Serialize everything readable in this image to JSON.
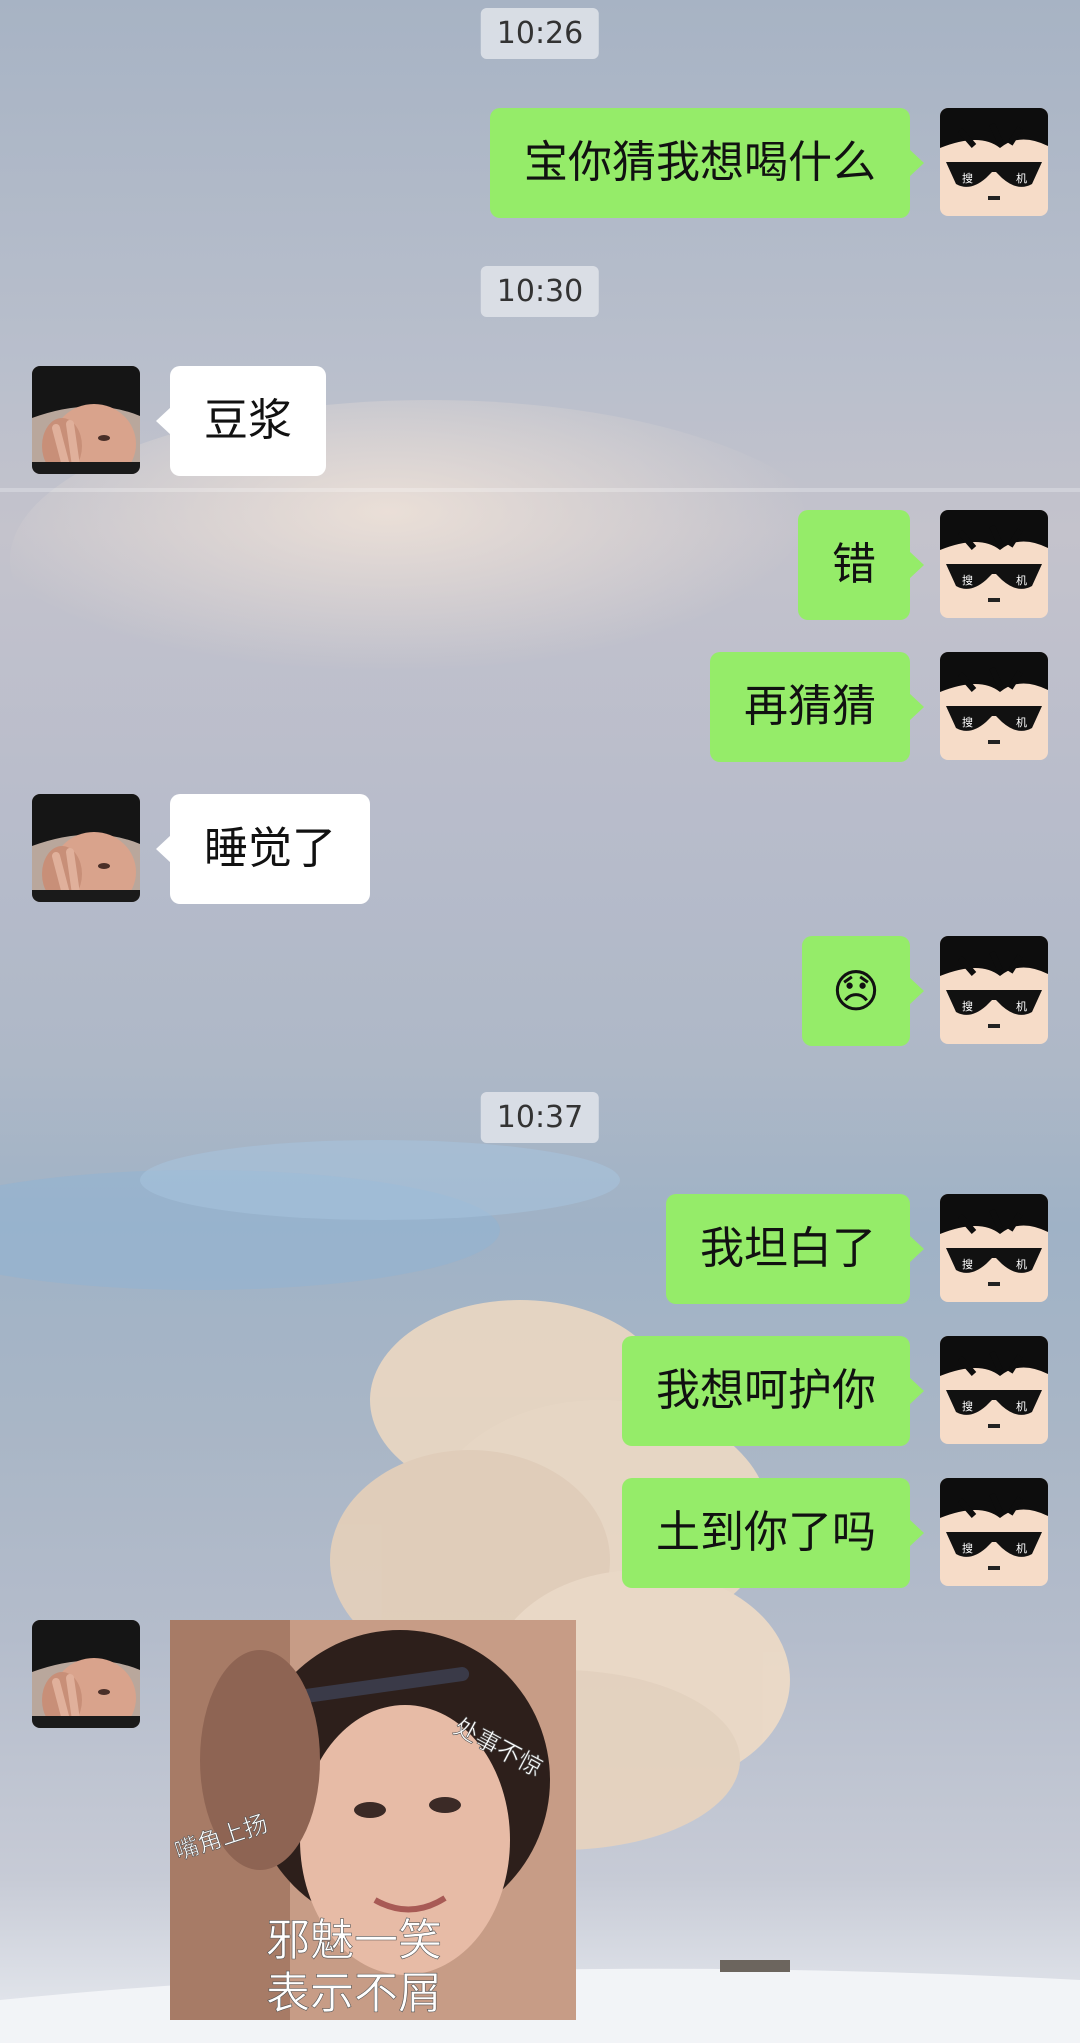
{
  "timestamps": [
    "10:26",
    "10:30",
    "10:37"
  ],
  "messages": {
    "m1": "宝你猜我想喝什么",
    "m2": "豆浆",
    "m3": "错",
    "m4": "再猜猜",
    "m5": "睡觉了",
    "m6": "😞",
    "m7": "我坦白了",
    "m8": "我想呵护你",
    "m9": "土到你了吗"
  },
  "sticker": {
    "label_top": "处事不惊",
    "label_left": "嘴角上扬",
    "line1": "邪魅一笑",
    "line2": "表示不屑"
  },
  "avatars": {
    "me": "cartoon-sunglasses-avatar",
    "friend": "man-in-beanie-avatar",
    "me_glasses_marks": [
      "搜",
      "机"
    ]
  },
  "colors": {
    "sent_bubble": "#95ec69",
    "received_bubble": "#ffffff"
  }
}
